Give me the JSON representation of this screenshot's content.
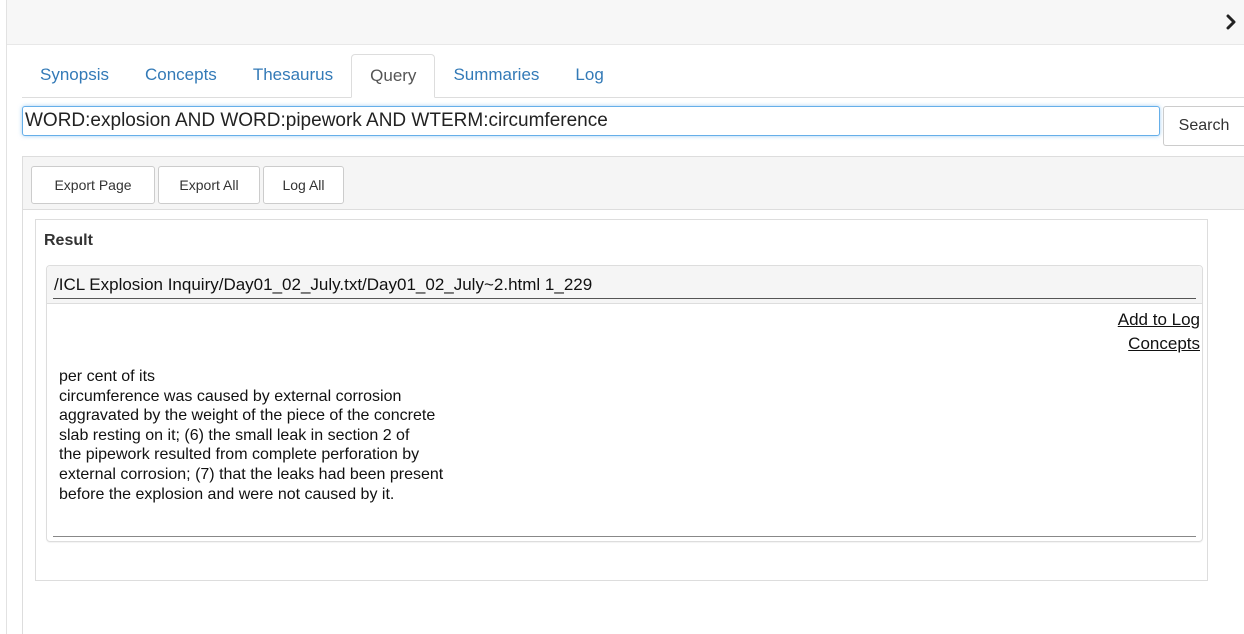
{
  "tabs": [
    {
      "label": "Synopsis",
      "active": false
    },
    {
      "label": "Concepts",
      "active": false
    },
    {
      "label": "Thesaurus",
      "active": false
    },
    {
      "label": "Query",
      "active": true
    },
    {
      "label": "Summaries",
      "active": false
    },
    {
      "label": "Log",
      "active": false
    }
  ],
  "query": {
    "value": "WORD:explosion AND WORD:pipework AND WTERM:circumference",
    "search_label": "Search"
  },
  "toolbar": {
    "export_page_label": "Export Page",
    "export_all_label": "Export All",
    "log_all_label": "Log All"
  },
  "result": {
    "title": "Result",
    "items": [
      {
        "path": "/ICL Explosion Inquiry/Day01_02_July.txt/Day01_02_July~2.html 1_229",
        "add_to_log_label": "Add to Log",
        "concepts_label": "Concepts",
        "lines": [
          "per cent of its",
          "circumference was caused by external corrosion",
          "aggravated by the weight of the piece of the concrete",
          "slab resting on it; (6) the small leak in section 2 of",
          "the pipework resulted from complete perforation by",
          "external corrosion; (7) that the leaks had been present",
          "before the explosion and were not caused by it."
        ]
      }
    ]
  },
  "icons": {
    "collapse": "chevron-right-icon"
  },
  "colors": {
    "link": "#337ab7",
    "focus_border": "#66afe9",
    "panel_bg": "#f5f5f5"
  }
}
